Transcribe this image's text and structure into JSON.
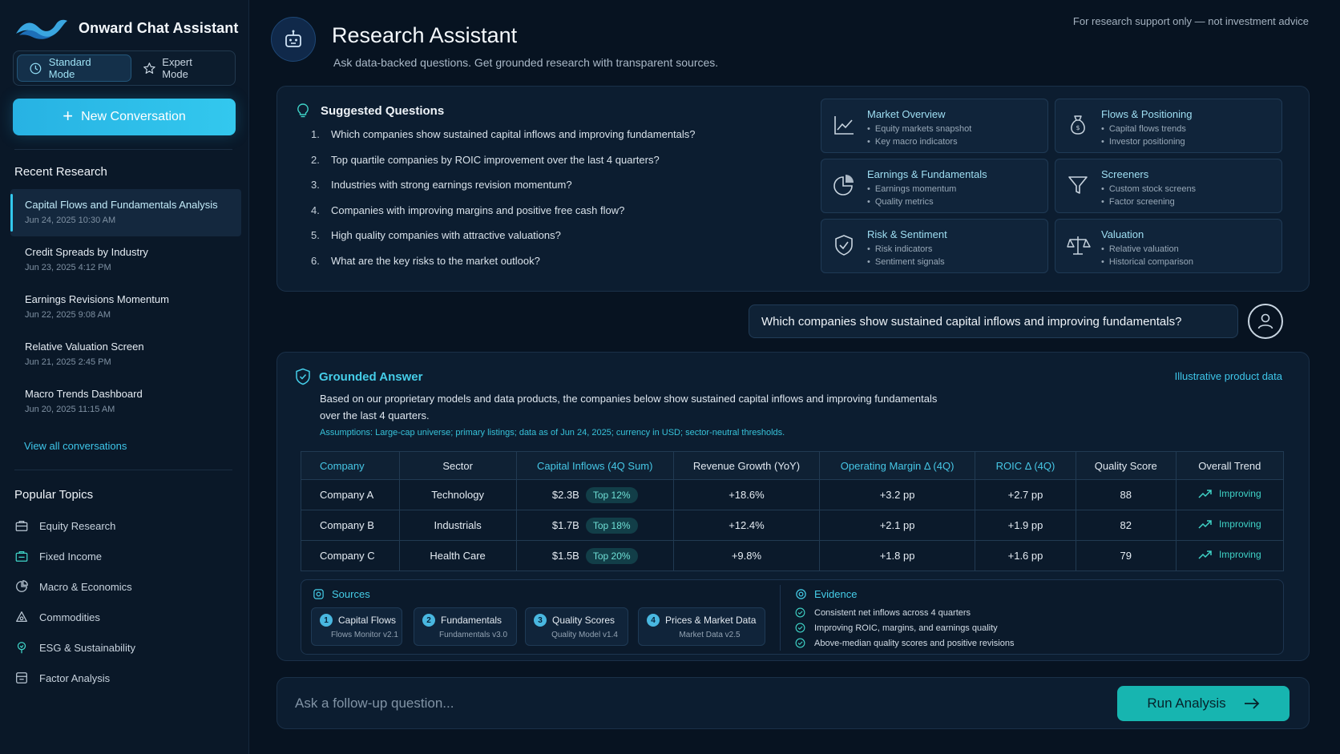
{
  "app": {
    "brand": "Onward Chat Assistant",
    "modes": [
      "Standard Mode",
      "Expert Mode"
    ],
    "active_mode": "Standard Mode",
    "new_conversation": "New Conversation"
  },
  "sidebar": {
    "recent_title": "Recent Research",
    "recent": [
      {
        "title": "Capital Flows and Fundamentals Analysis",
        "date": "Jun 24, 2025 10:30 AM",
        "active": true
      },
      {
        "title": "Credit Spreads by Industry",
        "date": "Jun 23, 2025 4:12 PM"
      },
      {
        "title": "Earnings Revisions Momentum",
        "date": "Jun 22, 2025 9:08 AM"
      },
      {
        "title": "Relative Valuation Screen",
        "date": "Jun 21, 2025 2:45 PM"
      },
      {
        "title": "Macro Trends Dashboard",
        "date": "Jun 20, 2025 11:15 AM"
      }
    ],
    "view_all": "View all conversations",
    "topics_title": "Popular Topics",
    "topics": [
      {
        "label": "Equity Research",
        "icon": "briefcase-icon"
      },
      {
        "label": "Fixed Income",
        "icon": "bond-icon"
      },
      {
        "label": "Macro & Economics",
        "icon": "pie-icon"
      },
      {
        "label": "Commodities",
        "icon": "commodity-icon"
      },
      {
        "label": "ESG & Sustainability",
        "icon": "leaf-icon"
      },
      {
        "label": "Factor Analysis",
        "icon": "database-icon"
      }
    ]
  },
  "header": {
    "title": "Research Assistant",
    "subtitle": "Ask data-backed questions. Get grounded research with transparent sources.",
    "disclaimer": "For research support only — not investment advice"
  },
  "suggested": {
    "title": "Suggested Questions",
    "questions": [
      "Which companies show sustained capital inflows and improving fundamentals?",
      "Top quartile companies by ROIC improvement over the last 4 quarters?",
      "Industries with strong earnings revision momentum?",
      "Companies with improving margins and positive free cash flow?",
      "High quality companies with attractive valuations?",
      "What are the key risks to the market outlook?"
    ],
    "tiles": [
      {
        "title": "Market Overview",
        "bullets": [
          "Equity markets snapshot",
          "Key macro indicators"
        ],
        "icon": "line-chart-icon"
      },
      {
        "title": "Flows & Positioning",
        "bullets": [
          "Capital flows trends",
          "Investor positioning"
        ],
        "icon": "money-bag-icon"
      },
      {
        "title": "Earnings & Fundamentals",
        "bullets": [
          "Earnings momentum",
          "Quality metrics"
        ],
        "icon": "pie-chart-icon"
      },
      {
        "title": "Screeners",
        "bullets": [
          "Custom stock screens",
          "Factor screening"
        ],
        "icon": "filter-icon"
      },
      {
        "title": "Risk & Sentiment",
        "bullets": [
          "Risk indicators",
          "Sentiment signals"
        ],
        "icon": "shield-icon"
      },
      {
        "title": "Valuation",
        "bullets": [
          "Relative valuation",
          "Historical comparison"
        ],
        "icon": "scale-icon"
      }
    ]
  },
  "user_message": "Which companies show sustained capital inflows and improving fundamentals?",
  "answer": {
    "title": "Grounded Answer",
    "note": "Illustrative product data",
    "body": "Based on our proprietary models and data products, the companies below show sustained capital inflows and improving fundamentals over the last 4 quarters.",
    "assumptions": "Assumptions: Large-cap universe; primary listings; data as of Jun 24, 2025; currency in USD; sector-neutral thresholds.",
    "columns": [
      "Company",
      "Sector",
      "Capital Inflows (4Q Sum)",
      "Revenue Growth (YoY)",
      "Operating Margin Δ (4Q)",
      "ROIC Δ (4Q)",
      "Quality Score",
      "Overall Trend"
    ],
    "rows": [
      {
        "company": "Company A",
        "sector": "Technology",
        "inflow": "$2.3B",
        "rank": "Top 12%",
        "rev": "+18.6%",
        "margin": "+3.2 pp",
        "roic": "+2.7 pp",
        "quality": "88",
        "trend": "Improving"
      },
      {
        "company": "Company B",
        "sector": "Industrials",
        "inflow": "$1.7B",
        "rank": "Top 18%",
        "rev": "+12.4%",
        "margin": "+2.1 pp",
        "roic": "+1.9 pp",
        "quality": "82",
        "trend": "Improving"
      },
      {
        "company": "Company C",
        "sector": "Health Care",
        "inflow": "$1.5B",
        "rank": "Top 20%",
        "rev": "+9.8%",
        "margin": "+1.8 pp",
        "roic": "+1.6 pp",
        "quality": "79",
        "trend": "Improving"
      }
    ],
    "sources_title": "Sources",
    "sources": [
      {
        "num": "1",
        "title": "Capital Flows",
        "version": "Flows Monitor v2.1"
      },
      {
        "num": "2",
        "title": "Fundamentals",
        "version": "Fundamentals v3.0"
      },
      {
        "num": "3",
        "title": "Quality Scores",
        "version": "Quality Model v1.4"
      },
      {
        "num": "4",
        "title": "Prices & Market Data",
        "version": "Market Data v2.5"
      }
    ],
    "evidence_title": "Evidence",
    "evidence": [
      "Consistent net inflows across 4 quarters",
      "Improving ROIC, margins, and earnings quality",
      "Above-median quality scores and positive revisions"
    ]
  },
  "followup": {
    "placeholder": "Ask a follow-up question...",
    "button": "Run Analysis"
  },
  "colors": {
    "accent": "#33c8ee",
    "teal": "#17b5b0",
    "background": "#071321"
  }
}
